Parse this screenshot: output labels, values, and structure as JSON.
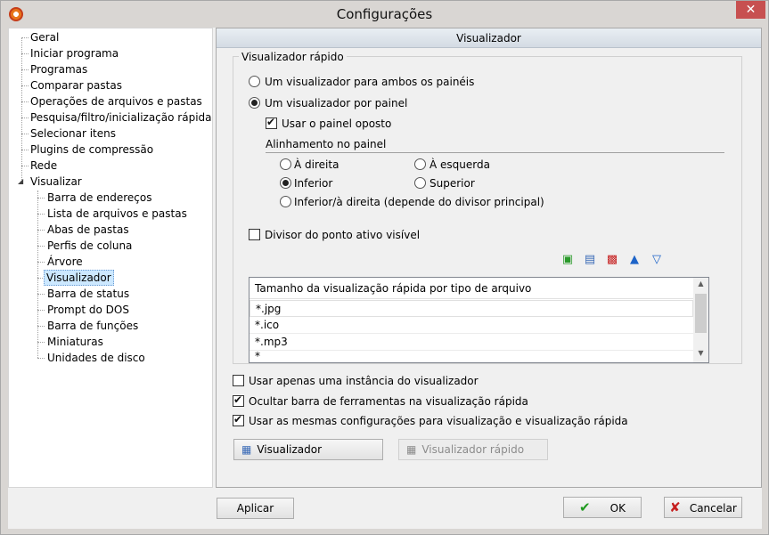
{
  "window": {
    "title": "Configurações",
    "close_glyph": "✕",
    "app_icon": "app-logo-icon"
  },
  "tree": {
    "items": [
      "Geral",
      "Iniciar programa",
      "Programas",
      "Comparar pastas",
      "Operações de arquivos e pastas",
      "Pesquisa/filtro/inicialização rápida",
      "Selecionar itens",
      "Plugins de compressão",
      "Rede",
      "Visualizar"
    ],
    "children": [
      "Barra de endereços",
      "Lista de arquivos e pastas",
      "Abas de pastas",
      "Perfis de coluna",
      "Árvore",
      "Visualizador",
      "Barra de status",
      "Prompt do DOS",
      "Barra de funções",
      "Miniaturas",
      "Unidades de disco"
    ],
    "selected": "Visualizador"
  },
  "panel": {
    "header": "Visualizador",
    "group_label": "Visualizador rápido",
    "radio_both": "Um visualizador para ambos os painéis",
    "radio_per_panel": "Um visualizador por painel",
    "check_opposite": "Usar o painel oposto",
    "alignment_label": "Alinhamento no painel",
    "align_right": "À direita",
    "align_left": "À esquerda",
    "align_bottom": "Inferior",
    "align_top": "Superior",
    "align_bottom_right": "Inferior/à direita (depende do divisor principal)",
    "check_divider": "Divisor do ponto ativo visível",
    "list_header": "Tamanho da visualização rápida por tipo de arquivo",
    "list_rows": [
      "*.jpg",
      "*.ico",
      "*.mp3",
      "*"
    ],
    "check_single_instance": "Usar apenas uma instância do visualizador",
    "check_hide_toolbar": "Ocultar barra de ferramentas na visualização rápida",
    "check_same_settings": "Usar as mesmas configurações para visualização e visualização rápida",
    "btn_viewer": "Visualizador",
    "btn_quick_viewer": "Visualizador rápido"
  },
  "footer": {
    "apply": "Aplicar",
    "ok": "OK",
    "cancel": "Cancelar"
  },
  "colors": {
    "selection": "#cce8ff",
    "close": "#c75050",
    "accent_blue": "#1e64c8"
  }
}
